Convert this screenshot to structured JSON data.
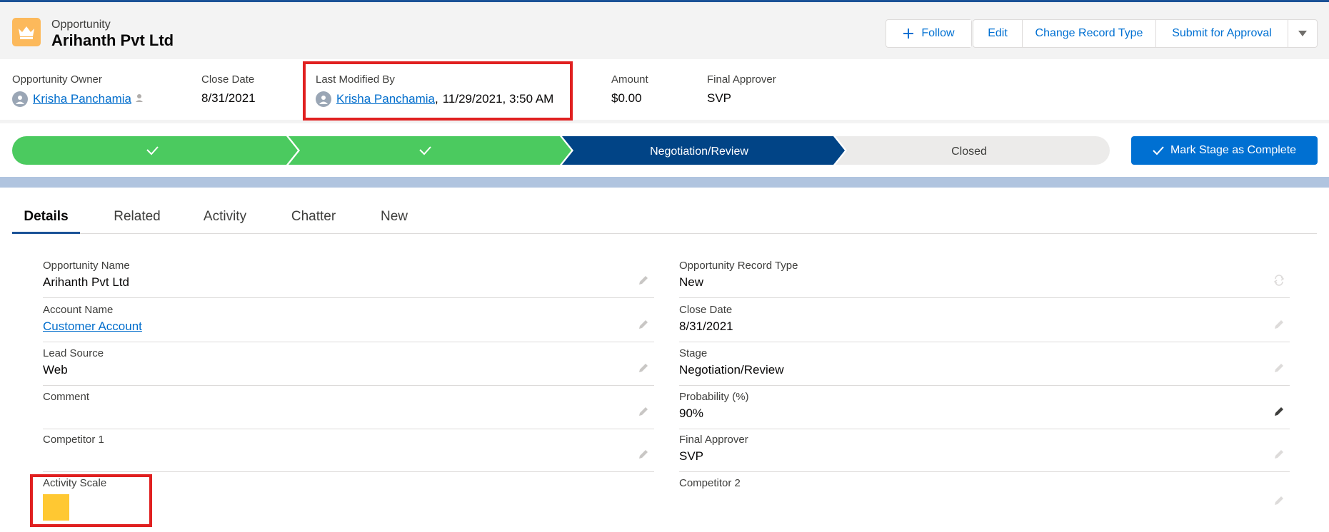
{
  "header": {
    "object_type": "Opportunity",
    "record_name": "Arihanth Pvt Ltd",
    "icon": "crown-icon",
    "actions": {
      "follow": "Follow",
      "edit": "Edit",
      "change_record_type": "Change Record Type",
      "submit_for_approval": "Submit for Approval"
    }
  },
  "highlights": {
    "owner": {
      "label": "Opportunity Owner",
      "value": "Krisha Panchamia"
    },
    "close_date": {
      "label": "Close Date",
      "value": "8/31/2021"
    },
    "last_modified": {
      "label": "Last Modified By",
      "user": "Krisha Panchamia",
      "separator": ",",
      "datetime": "11/29/2021, 3:50 AM"
    },
    "amount": {
      "label": "Amount",
      "value": "$0.00"
    },
    "final_approver": {
      "label": "Final Approver",
      "value": "SVP"
    }
  },
  "path": {
    "stages": [
      {
        "label": "",
        "status": "complete"
      },
      {
        "label": "",
        "status": "complete"
      },
      {
        "label": "Negotiation/Review",
        "status": "current"
      },
      {
        "label": "Closed",
        "status": "incomplete"
      }
    ],
    "complete_button": "Mark Stage as Complete"
  },
  "tabs": [
    "Details",
    "Related",
    "Activity",
    "Chatter",
    "New"
  ],
  "details": {
    "left": [
      {
        "label": "Opportunity Name",
        "value": "Arihanth Pvt Ltd"
      },
      {
        "label": "Account Name",
        "value": "Customer Account"
      },
      {
        "label": "Lead Source",
        "value": "Web"
      },
      {
        "label": "Comment",
        "value": ""
      },
      {
        "label": "Competitor 1",
        "value": ""
      },
      {
        "label": "Activity Scale",
        "value": ""
      }
    ],
    "right": [
      {
        "label": "Opportunity Record Type",
        "value": "New"
      },
      {
        "label": "Close Date",
        "value": "8/31/2021"
      },
      {
        "label": "Stage",
        "value": "Negotiation/Review"
      },
      {
        "label": "Probability (%)",
        "value": "90%"
      },
      {
        "label": "Final Approver",
        "value": "SVP"
      },
      {
        "label": "Competitor 2",
        "value": ""
      }
    ]
  },
  "colors": {
    "path_complete": "#4bca5f",
    "path_current": "#014486",
    "path_incomplete": "#ecebea",
    "activity_scale_swatch": "#ffc832",
    "highlight_box": "#e02020"
  }
}
